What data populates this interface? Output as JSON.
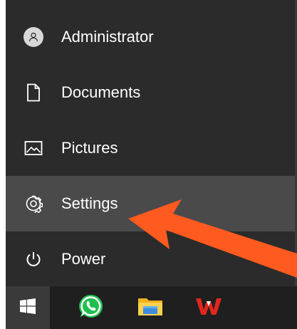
{
  "start_menu": {
    "items": [
      {
        "label": "Administrator",
        "icon": "user-avatar-icon"
      },
      {
        "label": "Documents",
        "icon": "document-icon"
      },
      {
        "label": "Pictures",
        "icon": "pictures-icon"
      },
      {
        "label": "Settings",
        "icon": "gear-icon",
        "highlighted": true
      },
      {
        "label": "Power",
        "icon": "power-icon"
      }
    ]
  },
  "taskbar": {
    "items": [
      {
        "icon": "windows-start-icon"
      },
      {
        "icon": "whatsapp-icon"
      },
      {
        "icon": "file-explorer-icon"
      },
      {
        "icon": "wps-office-icon"
      }
    ]
  },
  "annotation": {
    "arrow_color": "#ff5a1f",
    "target": "Settings"
  },
  "colors": {
    "panel_bg": "#2b2b2b",
    "selected_bg": "#4a4a4a",
    "taskbar_bg": "#1f1f1f",
    "text": "#ffffff"
  }
}
